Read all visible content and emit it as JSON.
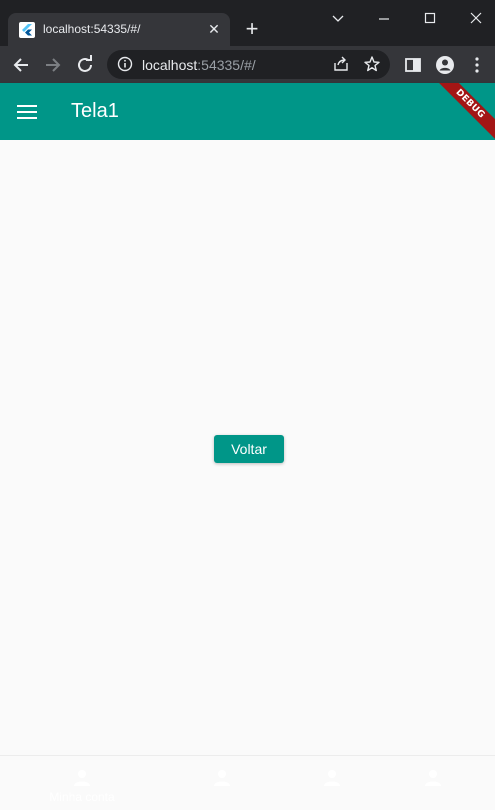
{
  "browser": {
    "tab_title": "localhost:54335/#/",
    "url_host": "localhost",
    "url_path": ":54335/#/",
    "icons": [
      "flutter-favicon",
      "close-icon",
      "plus-icon",
      "chevron-down-icon",
      "minimize-icon",
      "maximize-icon",
      "window-close-icon",
      "back-arrow-icon",
      "forward-arrow-icon",
      "reload-icon",
      "info-icon",
      "share-icon",
      "star-icon",
      "side-panel-icon",
      "profile-icon",
      "kebab-menu-icon"
    ]
  },
  "app": {
    "title": "Tela1",
    "debug_banner": "DEBUG",
    "primary_color": "#009688",
    "voltar_label": "Voltar"
  },
  "bottom_nav": {
    "items": [
      {
        "label": "Minha conta",
        "icon": "person-icon"
      },
      {
        "label": "",
        "icon": "person-icon"
      },
      {
        "label": "",
        "icon": "person-icon"
      },
      {
        "label": "",
        "icon": "person-icon"
      }
    ]
  }
}
